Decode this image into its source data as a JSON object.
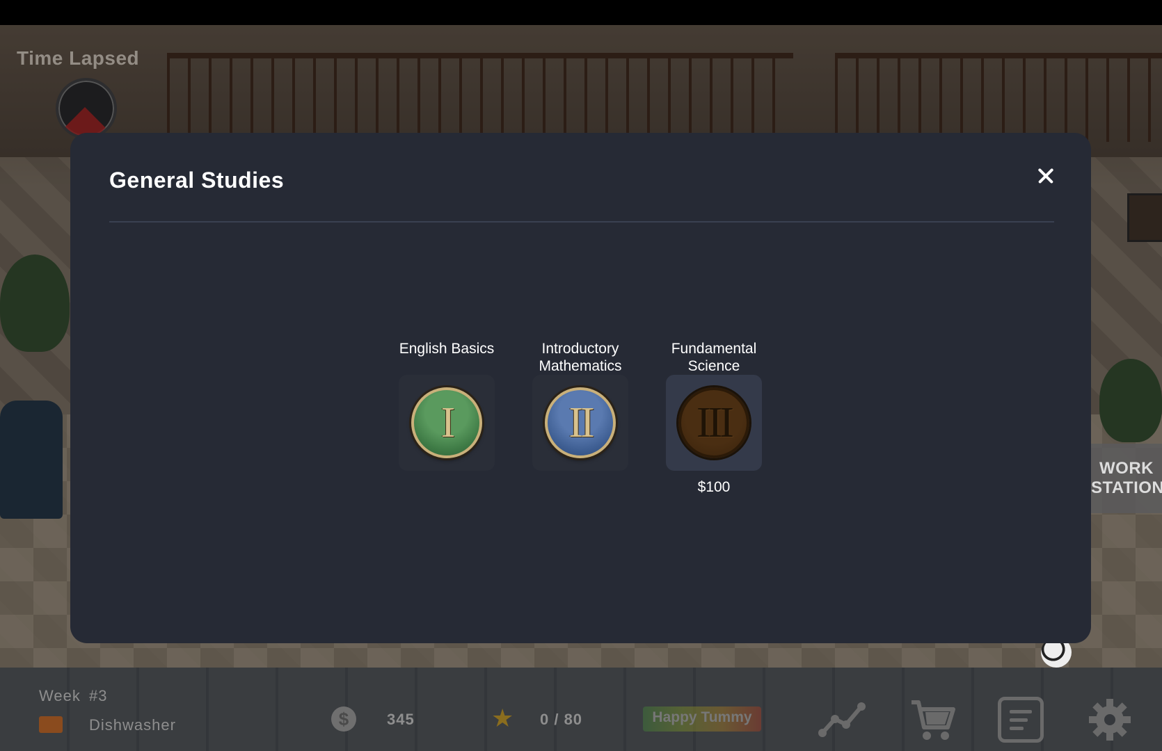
{
  "hud_top": {
    "time_label": "Time Lapsed"
  },
  "scene": {
    "workstation_sign": "WORK\nSTATION"
  },
  "modal": {
    "title": "General Studies",
    "courses": [
      {
        "name": "English Basics",
        "numeral": "I",
        "price": "",
        "color": "#3e7a45"
      },
      {
        "name": "Introductory Mathematics",
        "numeral": "II",
        "price": "",
        "color": "#3e5e92"
      },
      {
        "name": "Fundamental Science",
        "numeral": "III",
        "price": "$100",
        "color": "#3a230c"
      }
    ]
  },
  "hud": {
    "week_label": "Week",
    "week_value": "#3",
    "job": "Dishwasher",
    "money": "345",
    "stars": "0 / 80",
    "mood": "Happy Tummy"
  }
}
